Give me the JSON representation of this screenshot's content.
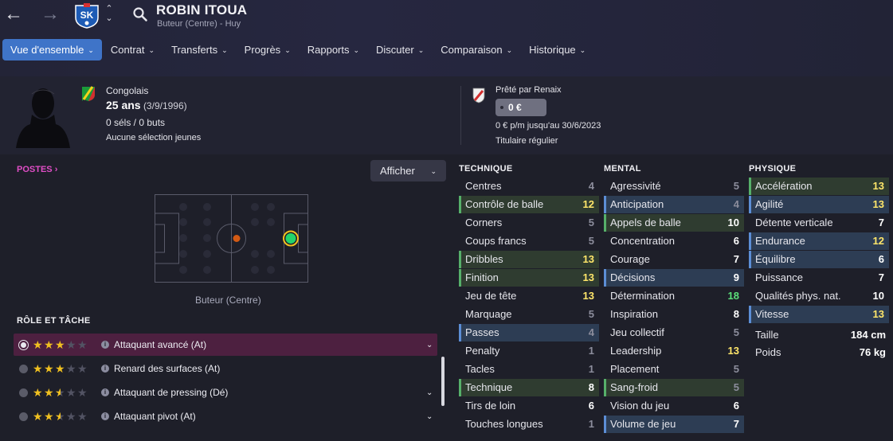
{
  "header": {
    "player_name": "ROBIN ITOUA",
    "player_subtitle": "Buteur (Centre) - Huy",
    "back_icon": "arrow-left-icon",
    "forward_icon": "arrow-right-icon",
    "club_logo_text": "SK"
  },
  "tabs": [
    {
      "label": "Vue d'ensemble",
      "active": true
    },
    {
      "label": "Contrat"
    },
    {
      "label": "Transferts"
    },
    {
      "label": "Progrès"
    },
    {
      "label": "Rapports"
    },
    {
      "label": "Discuter"
    },
    {
      "label": "Comparaison"
    },
    {
      "label": "Historique"
    }
  ],
  "info": {
    "nationality": "Congolais",
    "age": "25 ans",
    "dob": "(3/9/1996)",
    "caps": "0 séls / 0 buts",
    "youth": "Aucune sélection jeunes",
    "loan_from": "Prêté par Renaix",
    "fee": "0 €",
    "wage": "0 € p/m jusqu'au 30/6/2023",
    "status": "Titulaire régulier"
  },
  "left": {
    "postes_label": "POSTES",
    "afficher_label": "Afficher",
    "position_label": "Buteur (Centre)",
    "role_title": "RÔLE ET TÂCHE",
    "roles": [
      {
        "name": "Attaquant avancé (At)",
        "stars": 3,
        "selected": true
      },
      {
        "name": "Renard des surfaces (At)",
        "stars": 3,
        "selected": false
      },
      {
        "name": "Attaquant de pressing (Dé)",
        "stars": 2.5,
        "selected": false
      },
      {
        "name": "Attaquant pivot (At)",
        "stars": 2.5,
        "selected": false
      }
    ]
  },
  "attributes": {
    "technique_title": "TECHNIQUE",
    "mental_title": "MENTAL",
    "physique_title": "PHYSIQUE",
    "technique": [
      {
        "label": "Centres",
        "value": "4",
        "hl": ""
      },
      {
        "label": "Contrôle de balle",
        "value": "12",
        "hl": "g"
      },
      {
        "label": "Corners",
        "value": "5",
        "hl": ""
      },
      {
        "label": "Coups francs",
        "value": "5",
        "hl": ""
      },
      {
        "label": "Dribbles",
        "value": "13",
        "hl": "g"
      },
      {
        "label": "Finition",
        "value": "13",
        "hl": "g"
      },
      {
        "label": "Jeu de tête",
        "value": "13",
        "hl": ""
      },
      {
        "label": "Marquage",
        "value": "5",
        "hl": ""
      },
      {
        "label": "Passes",
        "value": "4",
        "hl": "b"
      },
      {
        "label": "Penalty",
        "value": "1",
        "hl": ""
      },
      {
        "label": "Tacles",
        "value": "1",
        "hl": ""
      },
      {
        "label": "Technique",
        "value": "8",
        "hl": "g"
      },
      {
        "label": "Tirs de loin",
        "value": "6",
        "hl": ""
      },
      {
        "label": "Touches longues",
        "value": "1",
        "hl": ""
      }
    ],
    "mental": [
      {
        "label": "Agressivité",
        "value": "5",
        "hl": ""
      },
      {
        "label": "Anticipation",
        "value": "4",
        "hl": "b"
      },
      {
        "label": "Appels de balle",
        "value": "10",
        "hl": "g"
      },
      {
        "label": "Concentration",
        "value": "6",
        "hl": ""
      },
      {
        "label": "Courage",
        "value": "7",
        "hl": ""
      },
      {
        "label": "Décisions",
        "value": "9",
        "hl": "b"
      },
      {
        "label": "Détermination",
        "value": "18",
        "hl": ""
      },
      {
        "label": "Inspiration",
        "value": "8",
        "hl": ""
      },
      {
        "label": "Jeu collectif",
        "value": "5",
        "hl": ""
      },
      {
        "label": "Leadership",
        "value": "13",
        "hl": ""
      },
      {
        "label": "Placement",
        "value": "5",
        "hl": ""
      },
      {
        "label": "Sang-froid",
        "value": "5",
        "hl": "g"
      },
      {
        "label": "Vision du jeu",
        "value": "6",
        "hl": ""
      },
      {
        "label": "Volume de jeu",
        "value": "7",
        "hl": "b"
      }
    ],
    "physique": [
      {
        "label": "Accélération",
        "value": "13",
        "hl": "g"
      },
      {
        "label": "Agilité",
        "value": "13",
        "hl": "b"
      },
      {
        "label": "Détente verticale",
        "value": "7",
        "hl": ""
      },
      {
        "label": "Endurance",
        "value": "12",
        "hl": "b"
      },
      {
        "label": "Équilibre",
        "value": "6",
        "hl": "b"
      },
      {
        "label": "Puissance",
        "value": "7",
        "hl": ""
      },
      {
        "label": "Qualités phys. nat.",
        "value": "10",
        "hl": ""
      },
      {
        "label": "Vitesse",
        "value": "13",
        "hl": "b"
      }
    ],
    "height_label": "Taille",
    "height_value": "184 cm",
    "weight_label": "Poids",
    "weight_value": "76 kg"
  },
  "colors": {
    "accent": "#3f74c8",
    "highlight_green": "#56b06a",
    "highlight_blue": "#5c8ed6",
    "value_high": "#ffe66a",
    "value_top": "#5be07a",
    "role_selected_bg": "#4d2040",
    "postes_link": "#e04ec6"
  }
}
